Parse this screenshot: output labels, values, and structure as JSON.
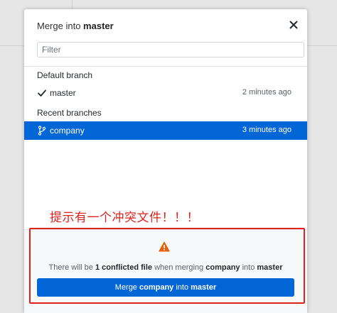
{
  "dialog": {
    "title_prefix": "Merge into ",
    "title_branch": "master",
    "filter_placeholder": "Filter"
  },
  "sections": {
    "default_label": "Default branch",
    "recent_label": "Recent branches"
  },
  "branches": {
    "default": {
      "name": "master",
      "time": "2 minutes ago"
    },
    "recent": [
      {
        "name": "company",
        "time": "3 minutes ago",
        "selected": true
      }
    ]
  },
  "footer": {
    "message_part1": "There will be ",
    "message_conflict": "1 conflicted file",
    "message_part2": " when merging ",
    "message_source": "company",
    "message_part3": " into ",
    "message_target": "master",
    "button_prefix": "Merge ",
    "button_source": "company",
    "button_middle": " into ",
    "button_target": "master"
  },
  "annotation": {
    "text": "提示有一个冲突文件！！！"
  },
  "colors": {
    "accent": "#0366d6",
    "warning": "#e36209",
    "annotation": "#e0211c"
  },
  "icons": {
    "close": "close-icon",
    "check": "check-icon",
    "branch": "git-branch-icon",
    "warning": "warning-icon"
  }
}
